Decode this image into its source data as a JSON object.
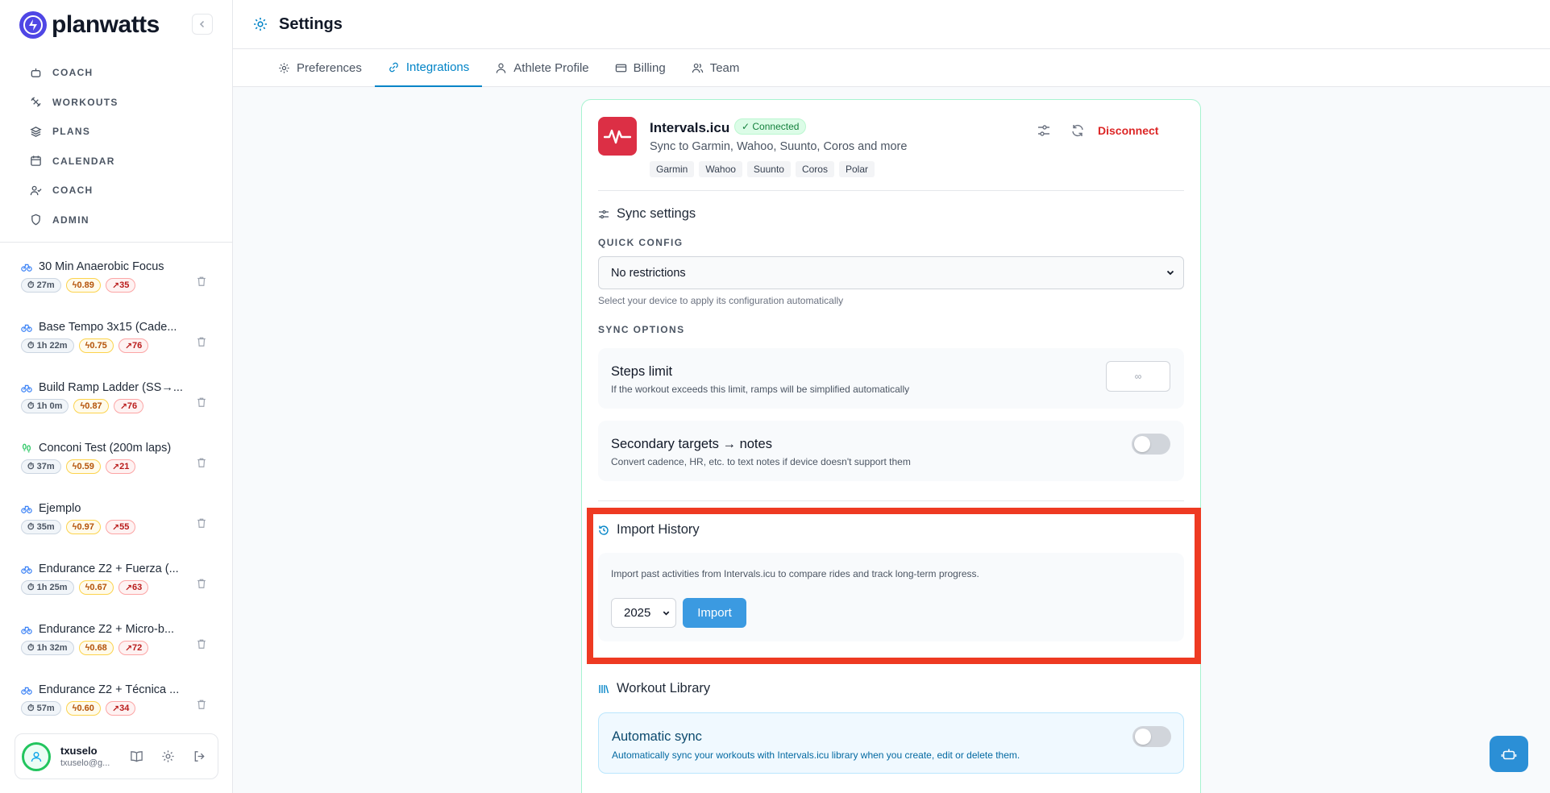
{
  "brand": {
    "name": "planwatts"
  },
  "sidebar": {
    "nav": [
      {
        "label": "COACH",
        "icon": "robot-icon"
      },
      {
        "label": "WORKOUTS",
        "icon": "dumbbell-icon"
      },
      {
        "label": "PLANS",
        "icon": "layers-icon"
      },
      {
        "label": "CALENDAR",
        "icon": "calendar-icon"
      },
      {
        "label": "COACH",
        "icon": "user-check-icon"
      },
      {
        "label": "ADMIN",
        "icon": "shield-icon"
      }
    ],
    "workouts": [
      {
        "title": "30 Min Anaerobic Focus",
        "duration": "27m",
        "intensity": "0.89",
        "tss": "35",
        "sport": "bike"
      },
      {
        "title": "Base Tempo 3x15 (Cade...",
        "duration": "1h 22m",
        "intensity": "0.75",
        "tss": "76",
        "sport": "bike"
      },
      {
        "title": "Build Ramp Ladder (SS→...",
        "duration": "1h 0m",
        "intensity": "0.87",
        "tss": "76",
        "sport": "bike"
      },
      {
        "title": "Conconi Test (200m laps)",
        "duration": "37m",
        "intensity": "0.59",
        "tss": "21",
        "sport": "run"
      },
      {
        "title": "Ejemplo",
        "duration": "35m",
        "intensity": "0.97",
        "tss": "55",
        "sport": "bike"
      },
      {
        "title": "Endurance Z2 + Fuerza (...",
        "duration": "1h 25m",
        "intensity": "0.67",
        "tss": "63",
        "sport": "bike"
      },
      {
        "title": "Endurance Z2 + Micro-b...",
        "duration": "1h 32m",
        "intensity": "0.68",
        "tss": "72",
        "sport": "bike"
      },
      {
        "title": "Endurance Z2 + Técnica ...",
        "duration": "57m",
        "intensity": "0.60",
        "tss": "34",
        "sport": "bike"
      }
    ],
    "user": {
      "name": "txuselo",
      "email": "txuselo@g..."
    }
  },
  "header": {
    "title": "Settings"
  },
  "tabs": [
    {
      "label": "Preferences",
      "active": false
    },
    {
      "label": "Integrations",
      "active": true
    },
    {
      "label": "Athlete Profile",
      "active": false
    },
    {
      "label": "Billing",
      "active": false
    },
    {
      "label": "Team",
      "active": false
    }
  ],
  "integration": {
    "name": "Intervals.icu",
    "status": "Connected",
    "description": "Sync to Garmin, Wahoo, Suunto, Coros and more",
    "devices": [
      "Garmin",
      "Wahoo",
      "Suunto",
      "Coros",
      "Polar"
    ],
    "disconnect_label": "Disconnect"
  },
  "sync_settings": {
    "title": "Sync settings",
    "quick_config_label": "QUICK CONFIG",
    "quick_config_value": "No restrictions",
    "quick_config_hint": "Select your device to apply its configuration automatically",
    "sync_options_label": "SYNC OPTIONS",
    "steps_limit": {
      "title": "Steps limit",
      "description": "If the workout exceeds this limit, ramps will be simplified automatically",
      "placeholder": "∞"
    },
    "secondary_targets": {
      "title": "Secondary targets → notes",
      "description": "Convert cadence, HR, etc. to text notes if device doesn't support them",
      "enabled": false
    }
  },
  "import_history": {
    "title": "Import History",
    "description": "Import past activities from Intervals.icu to compare rides and track long-term progress.",
    "year": "2025",
    "button_label": "Import"
  },
  "workout_library": {
    "title": "Workout Library",
    "auto_sync": {
      "title": "Automatic sync",
      "description": "Automatically sync your workouts with Intervals.icu library when you create, edit or delete them.",
      "enabled": false
    }
  },
  "colors": {
    "accent": "#0284c7",
    "danger": "#dc2626",
    "highlight": "#ee3a22",
    "brand_icon": "#dc2f45"
  }
}
